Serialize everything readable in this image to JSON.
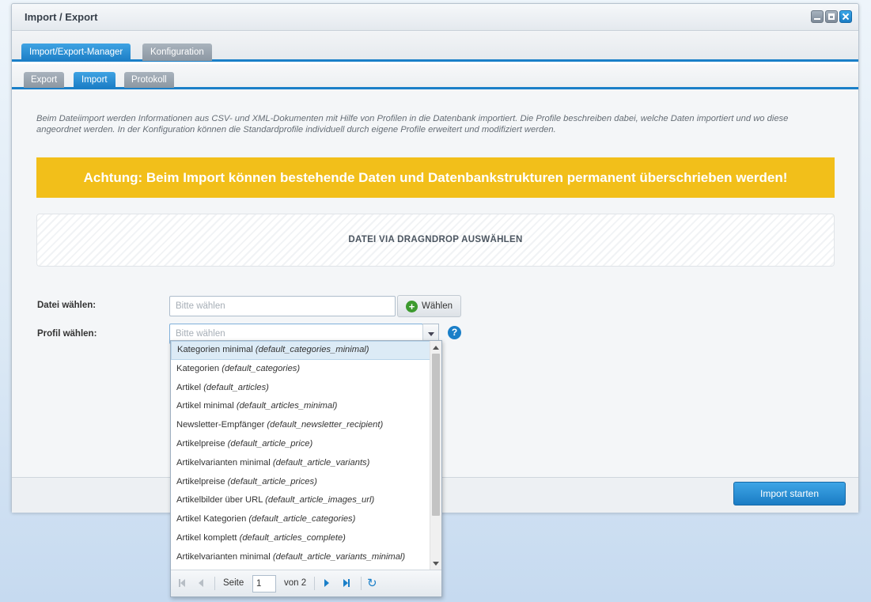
{
  "window": {
    "title": "Import / Export"
  },
  "main_tabs": [
    {
      "label": "Import/Export-Manager",
      "active": true
    },
    {
      "label": "Konfiguration",
      "active": false
    }
  ],
  "sub_tabs": [
    {
      "label": "Export",
      "active": false
    },
    {
      "label": "Import",
      "active": true
    },
    {
      "label": "Protokoll",
      "active": false
    }
  ],
  "import": {
    "intro": "Beim Dateiimport werden Informationen aus CSV- und XML-Dokumenten mit Hilfe von Profilen in die Datenbank importiert. Die Profile beschreiben dabei, welche Daten importiert und wo diese angeordnet werden. In der Konfiguration können die Standardprofile individuell durch eigene Profile erweitert und modifiziert werden.",
    "warning": "Achtung: Beim Import können bestehende Daten und Datenbankstrukturen permanent überschrieben werden!",
    "dropzone": "DATEI VIA DRAGNDROP AUSWÄHLEN",
    "file_label": "Datei wählen:",
    "file_placeholder": "Bitte wählen",
    "choose_button": "Wählen",
    "profile_label": "Profil wählen:",
    "profile_placeholder": "Bitte wählen",
    "help_icon_text": "?",
    "start_button": "Import starten"
  },
  "dropdown": {
    "items": [
      {
        "name": "Kategorien minimal",
        "key": "(default_categories_minimal)",
        "selected": true
      },
      {
        "name": "Kategorien",
        "key": "(default_categories)",
        "selected": false
      },
      {
        "name": "Artikel",
        "key": "(default_articles)",
        "selected": false
      },
      {
        "name": "Artikel minimal",
        "key": "(default_articles_minimal)",
        "selected": false
      },
      {
        "name": "Newsletter-Empfänger",
        "key": "(default_newsletter_recipient)",
        "selected": false
      },
      {
        "name": "Artikelpreise",
        "key": "(default_article_price)",
        "selected": false
      },
      {
        "name": "Artikelvarianten minimal",
        "key": "(default_article_variants)",
        "selected": false
      },
      {
        "name": "Artikelpreise",
        "key": "(default_article_prices)",
        "selected": false
      },
      {
        "name": "Artikelbilder über URL",
        "key": "(default_article_images_url)",
        "selected": false
      },
      {
        "name": "Artikel Kategorien",
        "key": "(default_article_categories)",
        "selected": false
      },
      {
        "name": "Artikel komplett",
        "key": "(default_articles_complete)",
        "selected": false
      },
      {
        "name": "Artikelvarianten minimal",
        "key": "(default_article_variants_minimal)",
        "selected": false
      }
    ],
    "pager": {
      "page_label": "Seite",
      "page_value": "1",
      "of_label": "von 2"
    }
  },
  "colors": {
    "accent": "#1a7fc8",
    "warning": "#f2bf1a",
    "plus_icon": "#3c9a2e"
  }
}
